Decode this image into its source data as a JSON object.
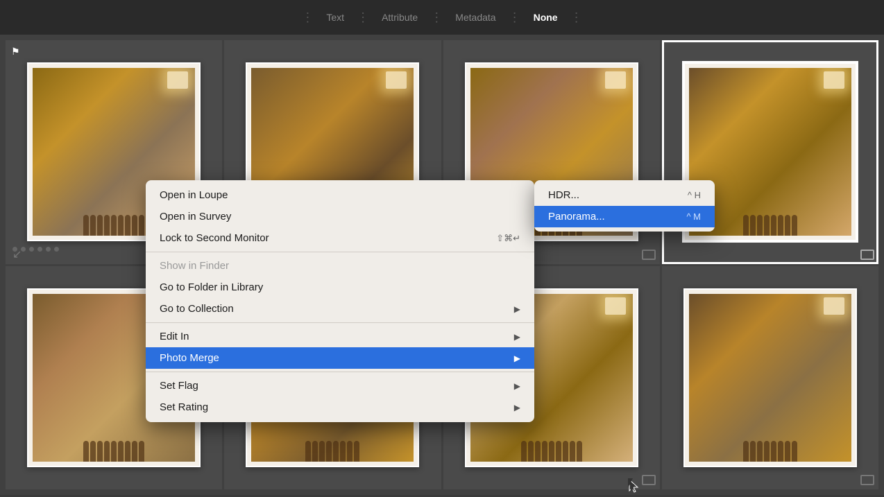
{
  "topbar": {
    "filter_tabs": [
      {
        "id": "text",
        "label": "Text",
        "active": false
      },
      {
        "id": "attribute",
        "label": "Attribute",
        "active": false
      },
      {
        "id": "metadata",
        "label": "Metadata",
        "active": false
      },
      {
        "id": "none",
        "label": "None",
        "active": true
      }
    ]
  },
  "photos": [
    {
      "id": "p1",
      "class": "p1",
      "selected": false,
      "has_flag": true,
      "has_dots": true,
      "has_stack_icon": true
    },
    {
      "id": "p2",
      "class": "p2",
      "selected": false,
      "has_flag": false,
      "has_dots": false,
      "has_badge": true
    },
    {
      "id": "p3",
      "class": "p3",
      "selected": false,
      "has_flag": false,
      "has_dots": false,
      "has_badge": true
    },
    {
      "id": "p4",
      "class": "p4",
      "selected": true,
      "has_flag": false,
      "has_dots": false,
      "has_badge": true
    },
    {
      "id": "p5",
      "class": "p5",
      "selected": false,
      "has_flag": false,
      "has_dots": false
    },
    {
      "id": "p6",
      "class": "p6",
      "selected": false,
      "has_flag": false,
      "has_dots": false
    },
    {
      "id": "p7",
      "class": "p7",
      "selected": false,
      "has_flag": false,
      "has_dots": false,
      "has_badge": true
    },
    {
      "id": "p8",
      "class": "p8",
      "selected": false,
      "has_flag": false,
      "has_dots": false,
      "has_badge": true
    }
  ],
  "context_menu": {
    "items": [
      {
        "id": "open-loupe",
        "label": "Open in Loupe",
        "shortcut": "",
        "has_arrow": false,
        "disabled": false,
        "highlighted": false
      },
      {
        "id": "open-survey",
        "label": "Open in Survey",
        "shortcut": "",
        "has_arrow": false,
        "disabled": false,
        "highlighted": false
      },
      {
        "id": "lock-second",
        "label": "Lock to Second Monitor",
        "shortcut": "⇧⌘↵",
        "has_arrow": false,
        "disabled": false,
        "highlighted": false
      },
      {
        "id": "divider1",
        "type": "divider"
      },
      {
        "id": "show-finder",
        "label": "Show in Finder",
        "shortcut": "",
        "has_arrow": false,
        "disabled": true,
        "highlighted": false
      },
      {
        "id": "go-folder",
        "label": "Go to Folder in Library",
        "shortcut": "",
        "has_arrow": false,
        "disabled": false,
        "highlighted": false
      },
      {
        "id": "go-collection",
        "label": "Go to Collection",
        "shortcut": "",
        "has_arrow": true,
        "disabled": false,
        "highlighted": false
      },
      {
        "id": "divider2",
        "type": "divider"
      },
      {
        "id": "edit-in",
        "label": "Edit In",
        "shortcut": "",
        "has_arrow": true,
        "disabled": false,
        "highlighted": false
      },
      {
        "id": "photo-merge",
        "label": "Photo Merge",
        "shortcut": "",
        "has_arrow": true,
        "disabled": false,
        "highlighted": true
      },
      {
        "id": "divider3",
        "type": "divider"
      },
      {
        "id": "set-flag",
        "label": "Set Flag",
        "shortcut": "",
        "has_arrow": true,
        "disabled": false,
        "highlighted": false
      },
      {
        "id": "set-rating",
        "label": "Set Rating",
        "shortcut": "",
        "has_arrow": true,
        "disabled": false,
        "highlighted": false
      }
    ]
  },
  "sub_menu": {
    "items": [
      {
        "id": "hdr",
        "label": "HDR...",
        "shortcut": "^ H",
        "highlighted": false
      },
      {
        "id": "panorama",
        "label": "Panorama...",
        "shortcut": "^ M",
        "highlighted": true
      }
    ]
  }
}
